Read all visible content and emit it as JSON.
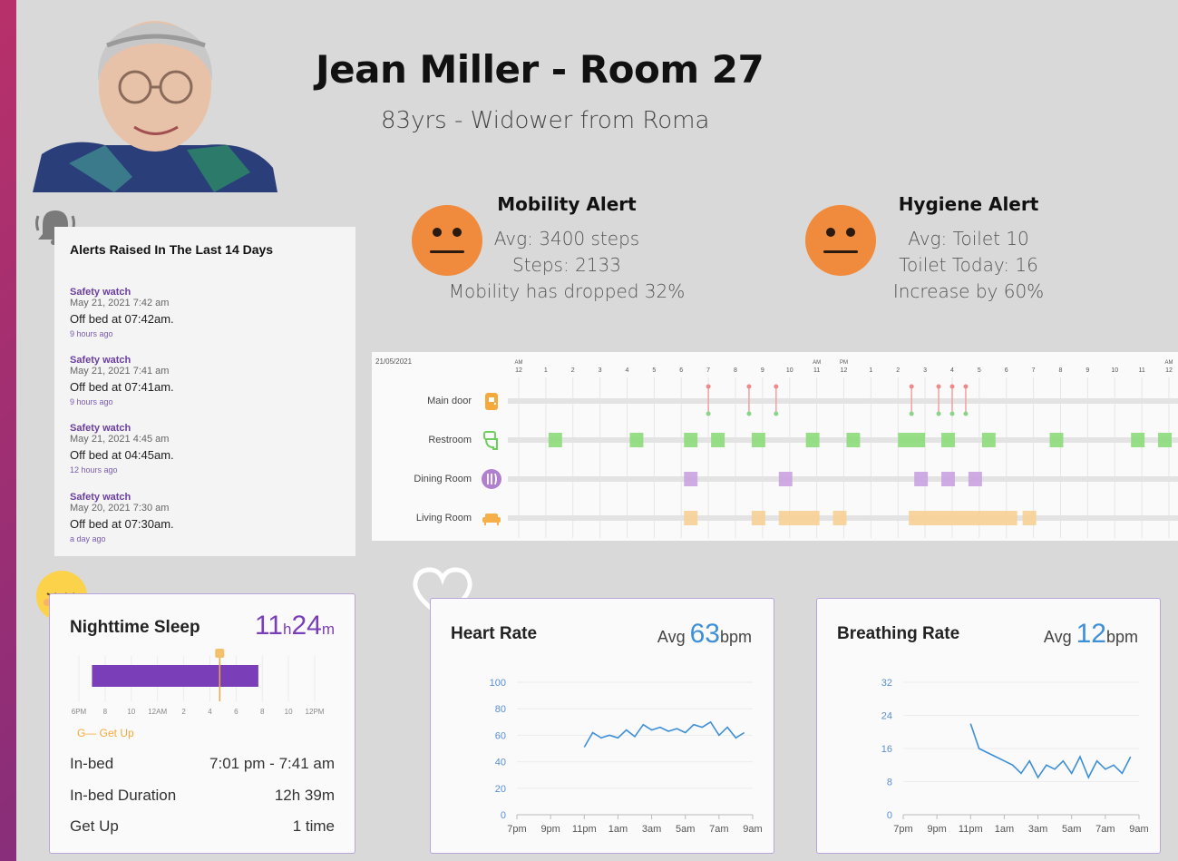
{
  "header": {
    "title": "Jean Miller - Room 27",
    "subtitle": "83yrs - Widower from Roma"
  },
  "alerts_panel": {
    "title": "Alerts Raised In The Last 14 Days",
    "items": [
      {
        "type": "Safety watch",
        "date": "May 21, 2021 7:42 am",
        "message": "Off bed at 07:42am.",
        "ago": "9 hours ago"
      },
      {
        "type": "Safety watch",
        "date": "May 21, 2021 7:41 am",
        "message": "Off bed at 07:41am.",
        "ago": "9 hours ago"
      },
      {
        "type": "Safety watch",
        "date": "May 21, 2021 4:45 am",
        "message": "Off bed at 04:45am.",
        "ago": "12 hours ago"
      },
      {
        "type": "Safety watch",
        "date": "May 20, 2021 7:30 am",
        "message": "Off bed at 07:30am.",
        "ago": "a day ago"
      }
    ]
  },
  "mobility_alert": {
    "title": "Mobility Alert",
    "lines": [
      "Avg: 3400 steps",
      "Steps: 2133",
      "Mobility has dropped 32%"
    ],
    "face_color": "#f08a3c"
  },
  "hygiene_alert": {
    "title": "Hygiene Alert",
    "lines": [
      "Avg: Toilet 10",
      "Toilet Today: 16",
      "Increase by 60%"
    ],
    "face_color": "#f08a3c"
  },
  "timeline": {
    "date": "21/05/2021",
    "hour_labels": [
      "12",
      "1",
      "2",
      "3",
      "4",
      "5",
      "6",
      "7",
      "8",
      "9",
      "10",
      "11",
      "12",
      "1",
      "2",
      "3",
      "4",
      "5",
      "6",
      "7",
      "8",
      "9",
      "10",
      "11",
      "12"
    ],
    "ampm_markers": {
      "0": "AM",
      "11": "AM",
      "12": "PM",
      "24": "AM"
    },
    "rows": [
      {
        "label": "Main door",
        "icon": "door-icon",
        "color": "#f5a93c"
      },
      {
        "label": "Restroom",
        "icon": "toilet-icon",
        "color": "#6fcf5c"
      },
      {
        "label": "Dining Room",
        "icon": "dining-icon",
        "color": "#b07fd0"
      },
      {
        "label": "Living Room",
        "icon": "sofa-icon",
        "color": "#f5b04a"
      }
    ],
    "door_events": [
      7,
      8.5,
      9.5,
      14.5,
      15.5,
      16,
      16.5
    ],
    "restroom_events": [
      [
        1.1,
        1.6
      ],
      [
        4.1,
        4.6
      ],
      [
        6.1,
        6.6
      ],
      [
        7.1,
        7.6
      ],
      [
        8.6,
        9.1
      ],
      [
        10.6,
        11.1
      ],
      [
        12.1,
        12.6
      ],
      [
        14,
        15
      ],
      [
        15.6,
        16.1
      ],
      [
        17.1,
        17.6
      ],
      [
        19.6,
        20.1
      ],
      [
        22.6,
        23.1
      ],
      [
        23.6,
        24.1
      ]
    ],
    "dining_events": [
      [
        6.1,
        6.6
      ],
      [
        9.6,
        10.1
      ],
      [
        14.6,
        15.1
      ],
      [
        15.6,
        16.1
      ],
      [
        16.6,
        17.1
      ]
    ],
    "living_events": [
      [
        6.1,
        6.6
      ],
      [
        8.6,
        9.1
      ],
      [
        9.6,
        11.1
      ],
      [
        11.6,
        12.1
      ],
      [
        14.4,
        15.4
      ],
      [
        15.4,
        18.4
      ],
      [
        18.6,
        19.1
      ]
    ]
  },
  "sleep": {
    "title": "Nighttime Sleep",
    "hours": "11",
    "hours_unit": "h",
    "minutes": "24",
    "minutes_unit": "m",
    "axis_labels": [
      "6PM",
      "8",
      "10",
      "12AM",
      "2",
      "4",
      "6",
      "8",
      "10",
      "12PM"
    ],
    "sleep_start_hour": 19.0,
    "sleep_end_hour": 31.7,
    "getup_hour": 28.75,
    "getup_legend": "G— Get Up",
    "rows": [
      {
        "key": "In-bed",
        "value": "7:01 pm - 7:41 am"
      },
      {
        "key": "In-bed Duration",
        "value": "12h 39m"
      },
      {
        "key": "Get Up",
        "value": "1 time"
      }
    ],
    "bar_color": "#7a3fb8"
  },
  "heart_rate": {
    "title": "Heart Rate",
    "avg_label": "Avg",
    "avg_value": "63",
    "unit": "bpm",
    "y_ticks": [
      "100",
      "80",
      "60",
      "40",
      "20",
      "0"
    ],
    "x_ticks": [
      "7pm",
      "9pm",
      "11pm",
      "1am",
      "3am",
      "5am",
      "7am",
      "9am"
    ]
  },
  "breathing_rate": {
    "title": "Breathing Rate",
    "avg_label": "Avg",
    "avg_value": "12",
    "unit": "bpm",
    "y_ticks": [
      "32",
      "24",
      "16",
      "8",
      "0"
    ],
    "x_ticks": [
      "7pm",
      "9pm",
      "11pm",
      "1am",
      "3am",
      "5am",
      "7am",
      "9am"
    ]
  },
  "chart_data": [
    {
      "type": "line",
      "title": "Heart Rate",
      "ylim": [
        0,
        100
      ],
      "x": [
        "11:00pm",
        "11:30pm",
        "12:00am",
        "12:30am",
        "1:00am",
        "1:30am",
        "2:00am",
        "2:30am",
        "3:00am",
        "3:30am",
        "4:00am",
        "4:30am",
        "5:00am",
        "5:30am",
        "6:00am",
        "6:30am",
        "7:00am",
        "7:30am",
        "8:00am",
        "8:30am"
      ],
      "series": [
        {
          "values": [
            51,
            62,
            58,
            60,
            58,
            64,
            59,
            68,
            64,
            66,
            63,
            65,
            62,
            68,
            66,
            70,
            60,
            66,
            58,
            62
          ]
        }
      ]
    },
    {
      "type": "line",
      "title": "Breathing Rate",
      "ylim": [
        0,
        32
      ],
      "x": [
        "11:00pm",
        "11:30pm",
        "12:00am",
        "12:30am",
        "1:00am",
        "1:30am",
        "2:00am",
        "2:30am",
        "3:00am",
        "3:30am",
        "4:00am",
        "4:30am",
        "5:00am",
        "5:30am",
        "6:00am",
        "6:30am",
        "7:00am",
        "7:30am",
        "8:00am",
        "8:30am"
      ],
      "series": [
        {
          "values": [
            22,
            16,
            15,
            14,
            13,
            12,
            10,
            13,
            9,
            12,
            11,
            13,
            10,
            14,
            9,
            13,
            11,
            12,
            10,
            14
          ]
        }
      ]
    }
  ]
}
